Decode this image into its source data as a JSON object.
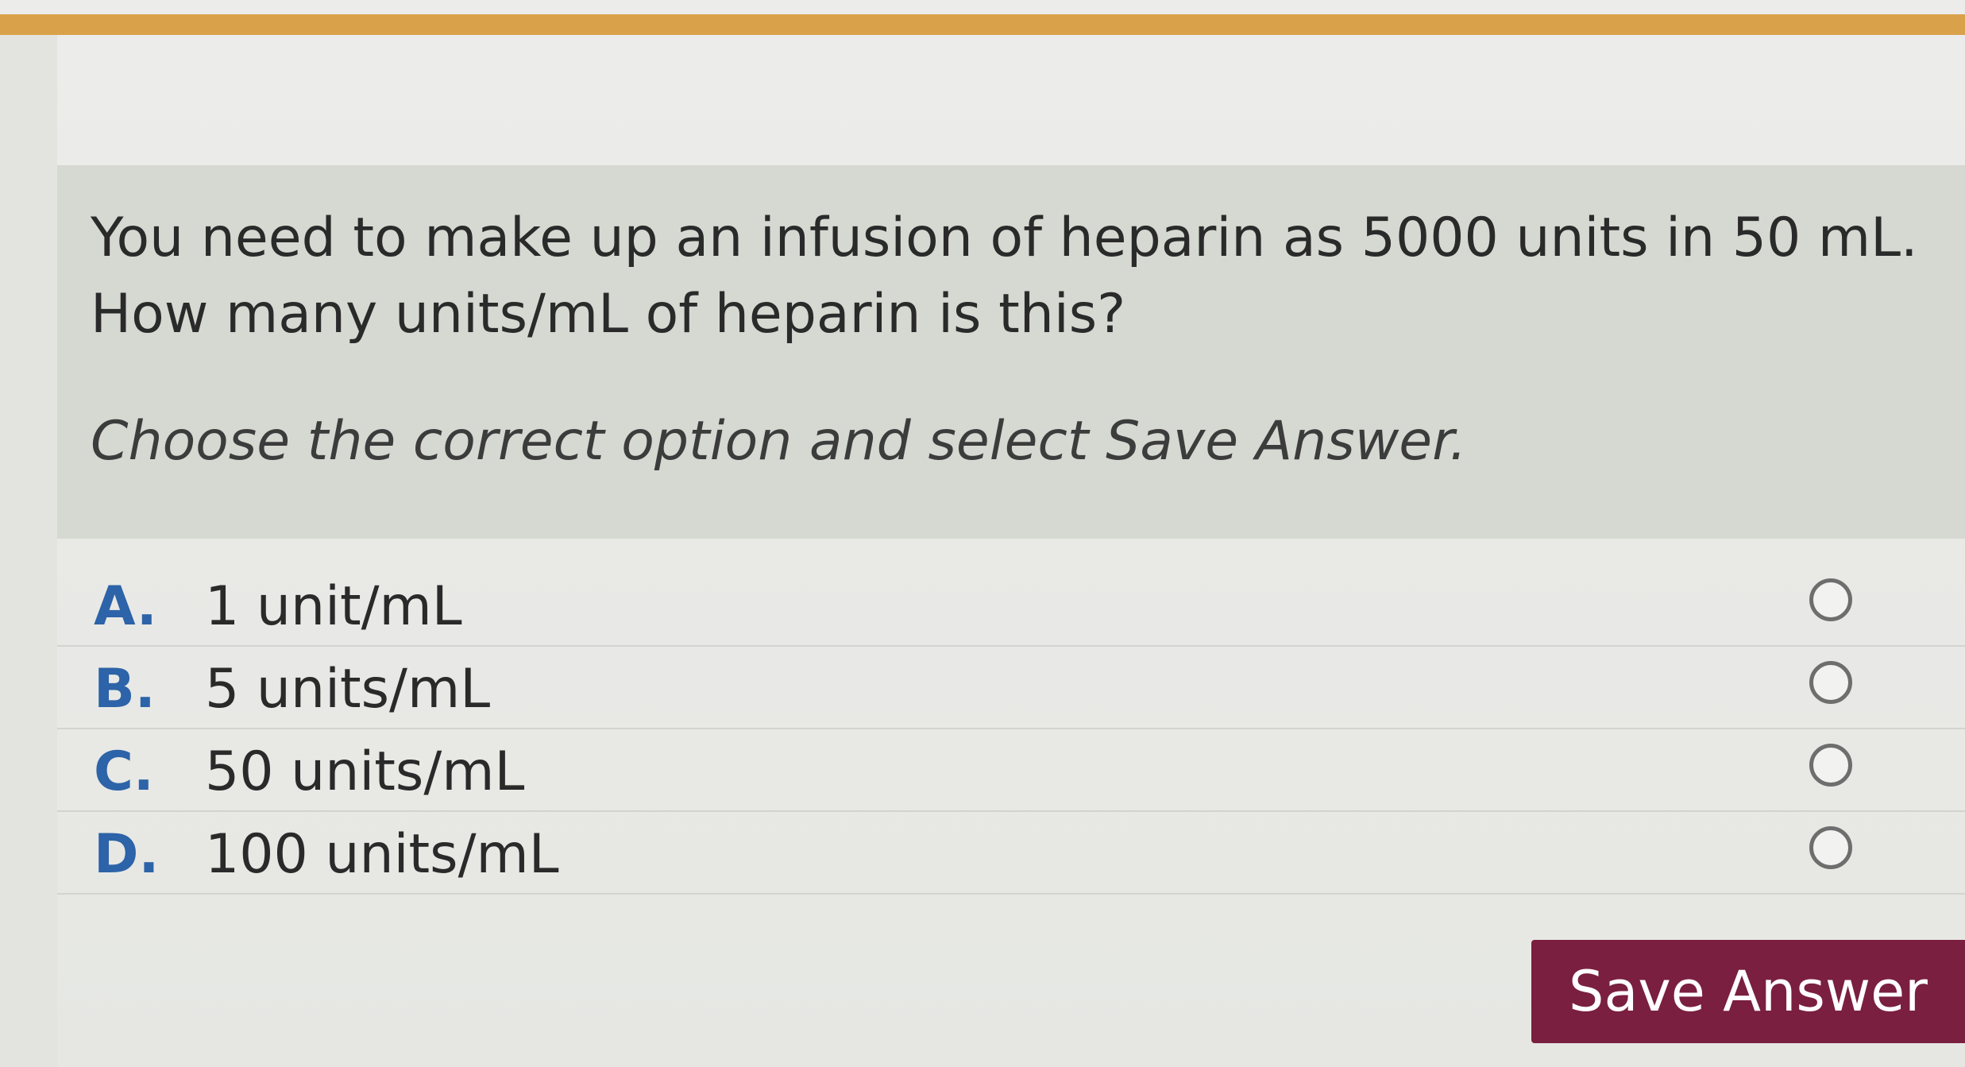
{
  "question": {
    "line1": "You need to make up an infusion of heparin as 5000 units in 50 mL.",
    "line2": "How many units/mL of heparin is this?",
    "instruction": "Choose the correct option and select Save Answer."
  },
  "options": [
    {
      "letter": "A.",
      "text": "1 unit/mL"
    },
    {
      "letter": "B.",
      "text": "5 units/mL"
    },
    {
      "letter": "C.",
      "text": "50 units/mL"
    },
    {
      "letter": "D.",
      "text": "100 units/mL"
    }
  ],
  "actions": {
    "save_label": "Save Answer"
  },
  "colors": {
    "accent_bar": "#d9a24a",
    "option_letter": "#2d63a8",
    "save_button": "#7a1f3f"
  }
}
